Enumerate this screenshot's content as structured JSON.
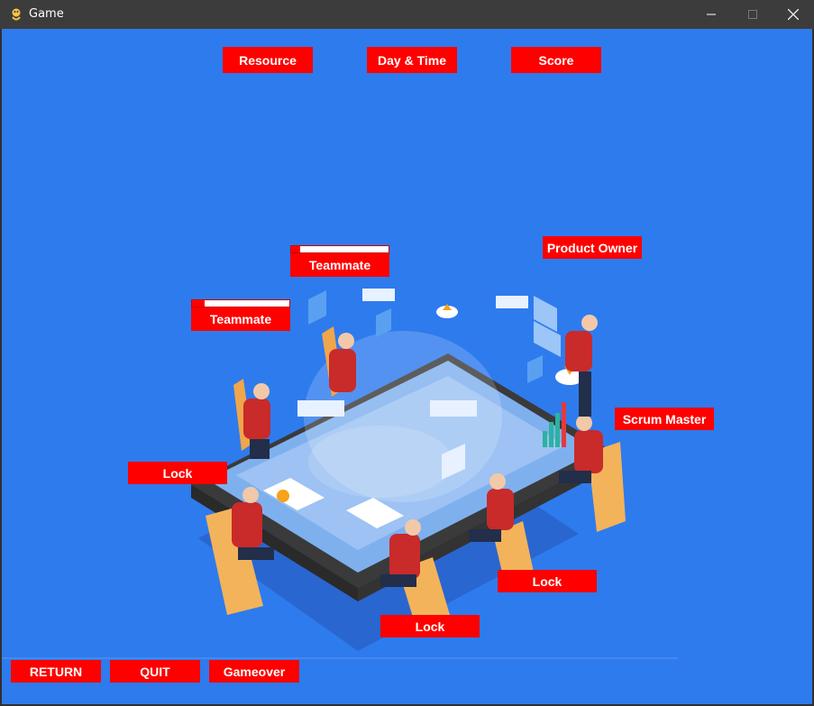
{
  "window": {
    "title": "Game"
  },
  "hud": {
    "resource": "Resource",
    "day_time": "Day & Time",
    "score": "Score"
  },
  "roles": {
    "teammate_top": "Teammate",
    "teammate_left": "Teammate",
    "product_owner": "Product Owner",
    "scrum_master": "Scrum Master"
  },
  "progress": {
    "teammate_top": 0.09,
    "teammate_left": 0.13
  },
  "locks": {
    "left": "Lock",
    "right": "Lock",
    "bottom": "Lock"
  },
  "buttons": {
    "return": "RETURN",
    "quit": "QUIT",
    "gameover": "Gameover"
  },
  "colors": {
    "background": "#2e7bee",
    "button": "#ff0000",
    "button_text": "#ffffff",
    "titlebar": "#3c3c3c"
  }
}
